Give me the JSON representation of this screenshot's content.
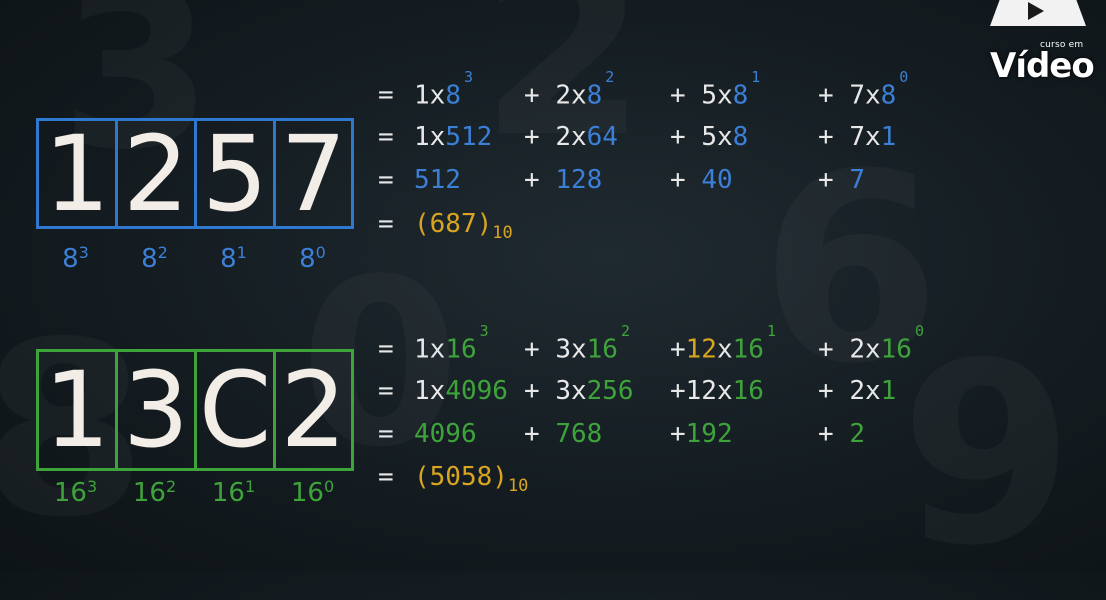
{
  "logo": {
    "small": "curso em",
    "big": "Vídeo"
  },
  "octal": {
    "digits": [
      "1",
      "2",
      "5",
      "7"
    ],
    "powers": [
      {
        "base": "8",
        "exp": "3"
      },
      {
        "base": "8",
        "exp": "2"
      },
      {
        "base": "8",
        "exp": "1"
      },
      {
        "base": "8",
        "exp": "0"
      }
    ],
    "row1": {
      "eq": "=",
      "t1": {
        "coef": "1x",
        "base": "8",
        "exp": "3"
      },
      "t2": {
        "op": "+",
        "coef": "2x",
        "base": "8",
        "exp": "2"
      },
      "t3": {
        "op": "+",
        "coef": "5x",
        "base": "8",
        "exp": "1"
      },
      "t4": {
        "op": "+",
        "coef": "7x",
        "base": "8",
        "exp": "0"
      }
    },
    "row2": {
      "eq": "=",
      "t1": {
        "coef": "1x",
        "val": "512"
      },
      "t2": {
        "op": "+",
        "coef": "2x",
        "val": "64"
      },
      "t3": {
        "op": "+",
        "coef": "5x",
        "val": "8"
      },
      "t4": {
        "op": "+",
        "coef": "7x",
        "val": "1"
      }
    },
    "row3": {
      "eq": "=",
      "t1": {
        "val": "512"
      },
      "t2": {
        "op": "+",
        "val": "128"
      },
      "t3": {
        "op": "+",
        "val": "40"
      },
      "t4": {
        "op": "+",
        "val": "7"
      }
    },
    "row4": {
      "eq": "=",
      "open": "(",
      "result": "687",
      "close": ")",
      "base": "10"
    }
  },
  "hex": {
    "digits": [
      "1",
      "3",
      "C",
      "2"
    ],
    "powers": [
      {
        "base": "16",
        "exp": "3"
      },
      {
        "base": "16",
        "exp": "2"
      },
      {
        "base": "16",
        "exp": "1"
      },
      {
        "base": "16",
        "exp": "0"
      }
    ],
    "row1": {
      "eq": "=",
      "t1": {
        "coef": "1x",
        "base": "16",
        "exp": "3"
      },
      "t2": {
        "op": "+",
        "coef": "3x",
        "base": "16",
        "exp": "2"
      },
      "t3": {
        "op": "+",
        "coef": "12",
        "mult": "x",
        "base": "16",
        "exp": "1"
      },
      "t4": {
        "op": "+",
        "coef": "2x",
        "base": "16",
        "exp": "0"
      }
    },
    "row2": {
      "eq": "=",
      "t1": {
        "coef": "1x",
        "val": "4096"
      },
      "t2": {
        "op": "+",
        "coef": "3x",
        "val": "256"
      },
      "t3": {
        "op": "+",
        "coef": "12x",
        "val": "16"
      },
      "t4": {
        "op": "+",
        "coef": "2x",
        "val": "1"
      }
    },
    "row3": {
      "eq": "=",
      "t1": {
        "val": "4096"
      },
      "t2": {
        "op": "+",
        "val": "768"
      },
      "t3": {
        "op": "+",
        "val": "192"
      },
      "t4": {
        "op": "+",
        "val": "2"
      }
    },
    "row4": {
      "eq": "=",
      "open": "(",
      "result": "5058",
      "close": ")",
      "base": "10"
    }
  }
}
